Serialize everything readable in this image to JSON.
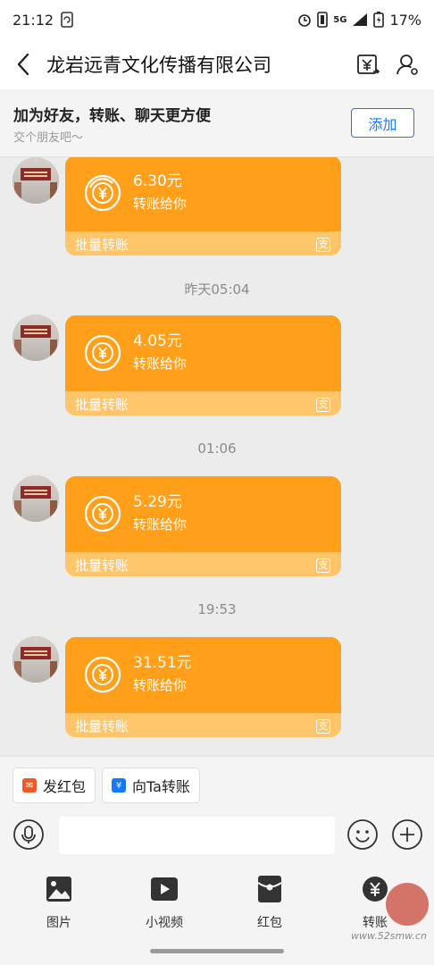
{
  "status_bar": {
    "time": "21:12",
    "network": "5G",
    "battery": "17%"
  },
  "nav": {
    "title": "龙岩远青文化传播有限公司"
  },
  "friend_banner": {
    "title": "加为好友，转账、聊天更方便",
    "subtitle": "交个朋友吧～",
    "add_label": "添加"
  },
  "messages": [
    {
      "amount": "6.30元",
      "subtitle": "转账给你",
      "footer": "批量转账"
    },
    {
      "timestamp": "昨天05:04",
      "amount": "4.05元",
      "subtitle": "转账给你",
      "footer": "批量转账"
    },
    {
      "timestamp": "01:06",
      "amount": "5.29元",
      "subtitle": "转账给你",
      "footer": "批量转账"
    },
    {
      "timestamp": "19:53",
      "amount": "31.51元",
      "subtitle": "转账给你",
      "footer": "批量转账"
    }
  ],
  "quick_actions": [
    {
      "label": "发红包",
      "icon": "red-envelope-icon"
    },
    {
      "label": "向Ta转账",
      "icon": "transfer-icon"
    }
  ],
  "toolbar": [
    {
      "label": "图片",
      "icon": "image-icon"
    },
    {
      "label": "小视频",
      "icon": "video-icon"
    },
    {
      "label": "红包",
      "icon": "red-packet-icon"
    },
    {
      "label": "转账",
      "icon": "transfer-icon"
    }
  ],
  "watermark": {
    "text": "www.52smw.cn"
  },
  "colors": {
    "bubble": "#ff9f1a",
    "bubble_footer": "#ffc56b",
    "accent": "#1677ff"
  }
}
